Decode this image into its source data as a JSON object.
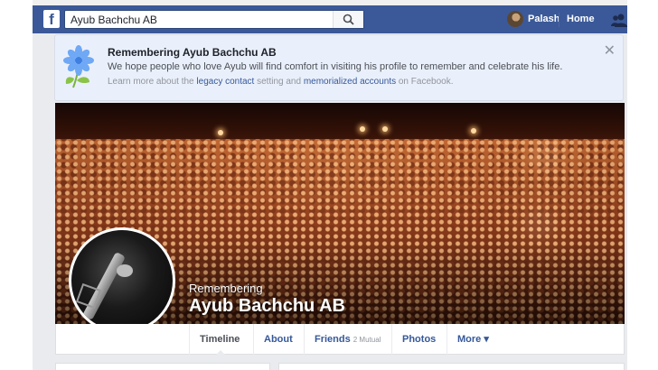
{
  "topbar": {
    "logo": "f",
    "search_value": "Ayub Bachchu AB",
    "search_icon": "search-icon",
    "user_name": "Palash",
    "home_label": "Home",
    "friends_icon": "friend-requests-icon",
    "bar_color": "#3b5998"
  },
  "banner": {
    "title": "Remembering Ayub Bachchu AB",
    "body": "We hope people who love Ayub will find comfort in visiting his profile to remember and celebrate his life.",
    "sub_prefix": "Learn more about the ",
    "sub_link1": "legacy contact",
    "sub_middle": " setting and ",
    "sub_link2": "memorialized accounts",
    "sub_suffix": " on Facebook.",
    "close_label": "✕",
    "icon": "memorial-flower-icon"
  },
  "cover": {
    "remembering": "Remembering",
    "name": "Ayub Bachchu AB"
  },
  "tabs": [
    {
      "label": "Timeline",
      "count": ""
    },
    {
      "label": "About",
      "count": ""
    },
    {
      "label": "Friends",
      "count": "2 Mutual"
    },
    {
      "label": "Photos",
      "count": ""
    },
    {
      "label": "More ▾",
      "count": ""
    }
  ]
}
